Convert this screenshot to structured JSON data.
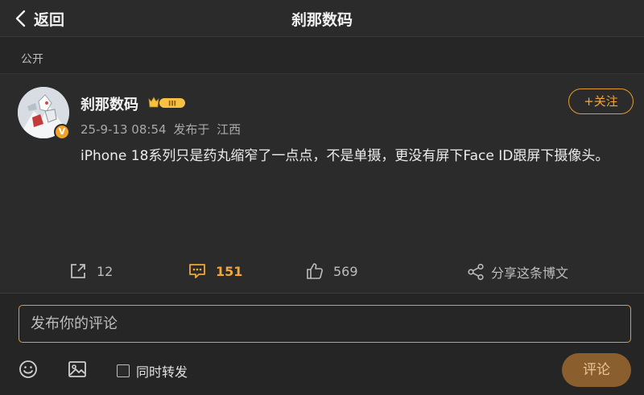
{
  "header": {
    "back_label": "返回",
    "title": "刹那数码"
  },
  "visibility_label": "公开",
  "post": {
    "username": "刹那数码",
    "vip_badge_text": "III",
    "verified_mark": "V",
    "timestamp": "25-9-13 08:54",
    "location_prefix": "发布于",
    "location": "江西",
    "follow_label": "+关注",
    "text": "iPhone 18系列只是药丸缩窄了一点点，不是单摄，更没有屏下Face ID跟屏下摄像头。"
  },
  "actions": {
    "repost_count": "12",
    "comment_count": "151",
    "like_count": "569",
    "share_label": "分享这条博文"
  },
  "comment_box": {
    "placeholder": "发布你的评论",
    "repost_label": "同时转发",
    "submit_label": "评论"
  },
  "colors": {
    "accent": "#f0a738",
    "background": "#2b2b2b",
    "submit_bg": "#8b5e2e"
  },
  "icons": {
    "back": "chevron-left-icon",
    "repost": "repost-icon",
    "comment": "comment-icon",
    "like": "thumbs-up-icon",
    "share": "share-icon",
    "emoji": "emoji-icon",
    "image": "image-icon"
  }
}
